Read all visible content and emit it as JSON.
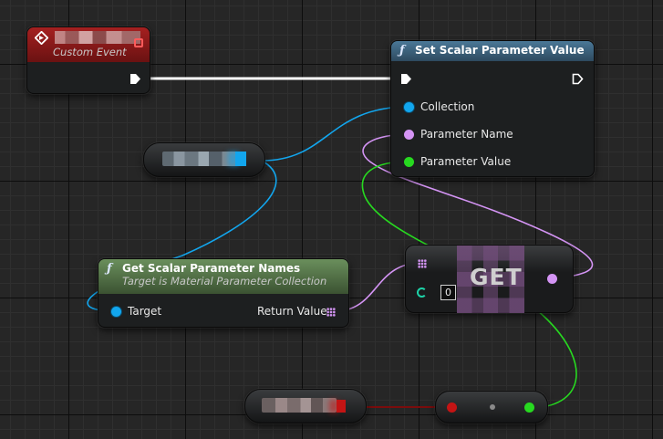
{
  "custom_event": {
    "title_redacted": true,
    "subtitle": "Custom Event"
  },
  "set_scalar": {
    "title": "Set Scalar Parameter Value",
    "pins": {
      "collection": "Collection",
      "parameter_name": "Parameter Name",
      "parameter_value": "Parameter Value"
    }
  },
  "get_names": {
    "title": "Get Scalar Parameter Names",
    "subtitle": "Target is Material Parameter Collection",
    "target_label": "Target",
    "return_label": "Return Value"
  },
  "get_node": {
    "label": "GET",
    "index_value": "0"
  },
  "colors": {
    "exec": "#ffffff",
    "object_pin": "#12a6ee",
    "name_pin": "#d494f4",
    "float_pin": "#27d920",
    "red_pin": "#c41414",
    "event_header": "#8a1a1a",
    "function_header": "#3c5f78",
    "pure_header": "#4e7a3e"
  }
}
